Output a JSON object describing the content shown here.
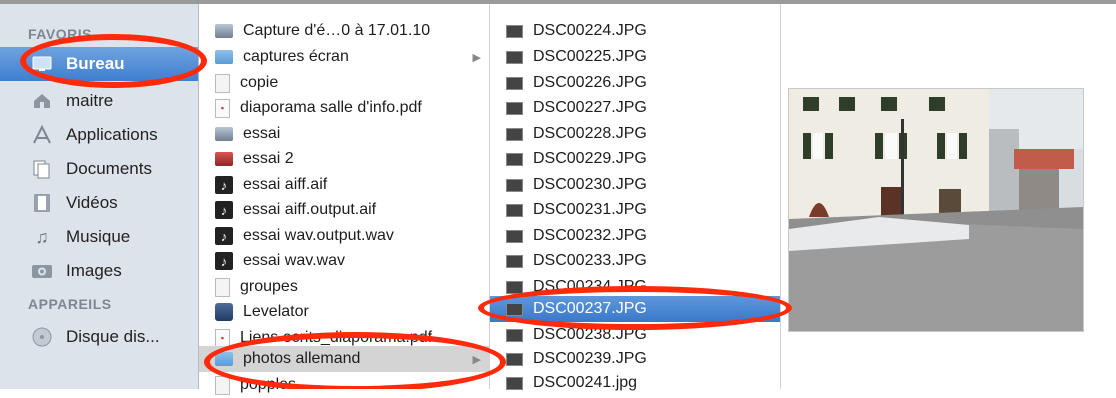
{
  "sidebar": {
    "favorites_header": "FAVORIS",
    "devices_header": "APPAREILS",
    "favorites": [
      {
        "label": "Bureau",
        "icon": "desktop-icon"
      },
      {
        "label": "maitre",
        "icon": "home-icon"
      },
      {
        "label": "Applications",
        "icon": "applications-icon"
      },
      {
        "label": "Documents",
        "icon": "documents-icon"
      },
      {
        "label": "Vidéos",
        "icon": "movies-icon"
      },
      {
        "label": "Musique",
        "icon": "music-icon"
      },
      {
        "label": "Images",
        "icon": "pictures-icon"
      }
    ],
    "devices": [
      {
        "label": "Disque dis...",
        "icon": "disk-icon"
      }
    ]
  },
  "column1": {
    "items": [
      {
        "label": "Capture d'é…0 à 17.01.10",
        "icon": "image-file-icon"
      },
      {
        "label": "captures écran",
        "icon": "folder-icon"
      },
      {
        "label": "copie",
        "icon": "document-icon"
      },
      {
        "label": "diaporama salle d'info.pdf",
        "icon": "pdf-icon"
      },
      {
        "label": "essai",
        "icon": "image-file-icon"
      },
      {
        "label": "essai 2",
        "icon": "image-file-icon"
      },
      {
        "label": "essai aiff.aif",
        "icon": "audio-file-icon"
      },
      {
        "label": "essai aiff.output.aif",
        "icon": "audio-file-icon"
      },
      {
        "label": "essai wav.output.wav",
        "icon": "audio-file-icon"
      },
      {
        "label": "essai wav.wav",
        "icon": "audio-file-icon"
      },
      {
        "label": "groupes",
        "icon": "document-icon"
      },
      {
        "label": "Levelator",
        "icon": "application-icon"
      },
      {
        "label": "Liens ecrits_diaporama.pdf",
        "icon": "pdf-icon"
      },
      {
        "label": "photos allemand",
        "icon": "folder-icon"
      },
      {
        "label": "popples",
        "icon": "document-icon"
      }
    ]
  },
  "column2": {
    "items": [
      {
        "label": "DSC00224.JPG"
      },
      {
        "label": "DSC00225.JPG"
      },
      {
        "label": "DSC00226.JPG"
      },
      {
        "label": "DSC00227.JPG"
      },
      {
        "label": "DSC00228.JPG"
      },
      {
        "label": "DSC00229.JPG"
      },
      {
        "label": "DSC00230.JPG"
      },
      {
        "label": "DSC00231.JPG"
      },
      {
        "label": "DSC00232.JPG"
      },
      {
        "label": "DSC00233.JPG"
      },
      {
        "label": "DSC00234.JPG"
      },
      {
        "label": "DSC00237.JPG"
      },
      {
        "label": "DSC00238.JPG"
      },
      {
        "label": "DSC00239.JPG"
      },
      {
        "label": "DSC00241.jpg"
      }
    ]
  },
  "colors": {
    "selection": "#3f7fcf",
    "annotation_ring": "#ff2a0a",
    "sidebar_bg": "#dde3ea"
  }
}
